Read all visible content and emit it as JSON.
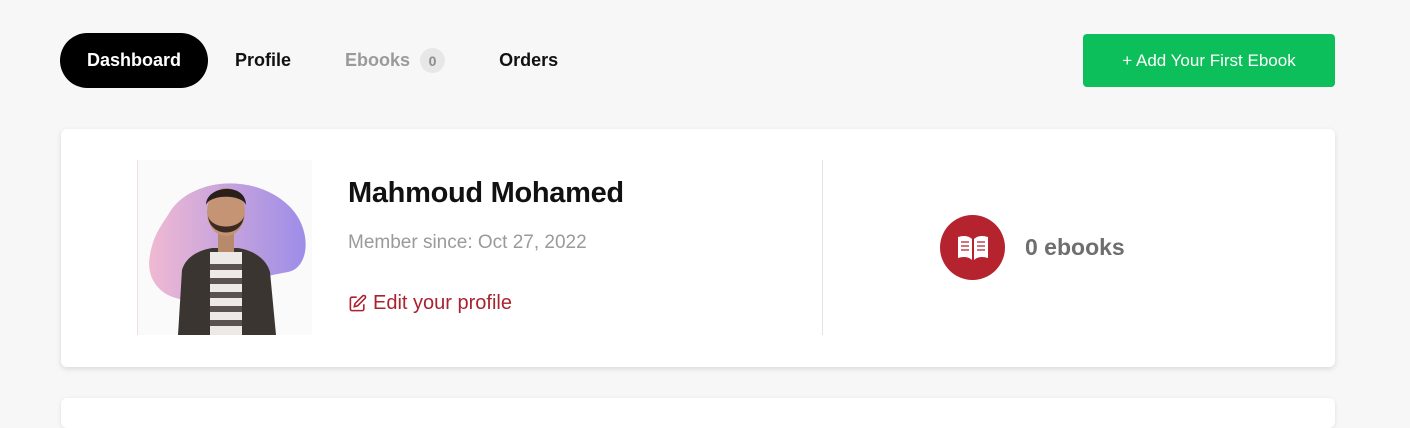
{
  "nav": {
    "tabs": [
      {
        "label": "Dashboard"
      },
      {
        "label": "Profile"
      },
      {
        "label": "Ebooks",
        "badge": "0"
      },
      {
        "label": "Orders"
      }
    ]
  },
  "actions": {
    "add_ebook_label": "+ Add Your First Ebook"
  },
  "profile": {
    "name": "Mahmoud Mohamed",
    "member_since": "Member since: Oct 27, 2022",
    "edit_label": "Edit your profile"
  },
  "stats": {
    "ebooks_label": "0 ebooks"
  },
  "colors": {
    "accent_green": "#0cbf5a",
    "accent_red": "#b5232f",
    "link_red": "#a8232f",
    "active_tab": "#000000"
  },
  "icons": {
    "edit": "edit-icon",
    "book": "open-book-icon",
    "avatar": "user-photo"
  }
}
